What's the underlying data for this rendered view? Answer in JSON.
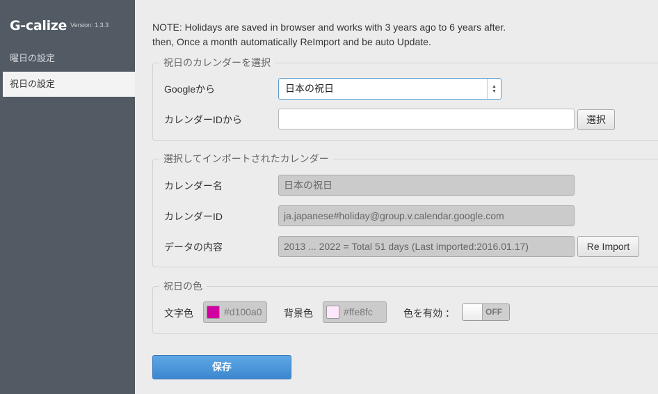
{
  "app": {
    "name": "G-calize",
    "version": "Version: 1.3.3"
  },
  "sidebar": {
    "items": [
      {
        "label": "曜日の設定"
      },
      {
        "label": "祝日の設定"
      }
    ]
  },
  "note": {
    "line1": "NOTE: Holidays are saved in browser and works with 3 years ago to 6 years after.",
    "line2": "then, Once a month automatically ReImport and be auto Update."
  },
  "select_calendar": {
    "legend": "祝日のカレンダーを選択",
    "google_label": "Googleから",
    "google_selected": "日本の祝日",
    "id_label": "カレンダーIDから",
    "id_value": "",
    "select_button": "選択"
  },
  "imported": {
    "legend": "選択してインポートされたカレンダー",
    "name_label": "カレンダー名",
    "name_value": "日本の祝日",
    "id_label": "カレンダーID",
    "id_value": "ja.japanese#holiday@group.v.calendar.google.com",
    "content_label": "データの内容",
    "content_value": "2013 ... 2022 = Total 51 days (Last imported:2016.01.17)",
    "reimport_button": "Re Import"
  },
  "holiday_color": {
    "legend": "祝日の色",
    "text_color_label": "文字色",
    "text_color_value": "#d100a0",
    "bg_color_label": "背景色",
    "bg_color_value": "#ffe8fc",
    "enable_label": "色を有効 ：",
    "toggle_state": "OFF"
  },
  "save_button": "保存",
  "colors": {
    "sidebar_bg": "#525a63",
    "accent": "#4a90d9",
    "text_swatch": "#d100a0",
    "bg_swatch": "#ffe8fc"
  }
}
